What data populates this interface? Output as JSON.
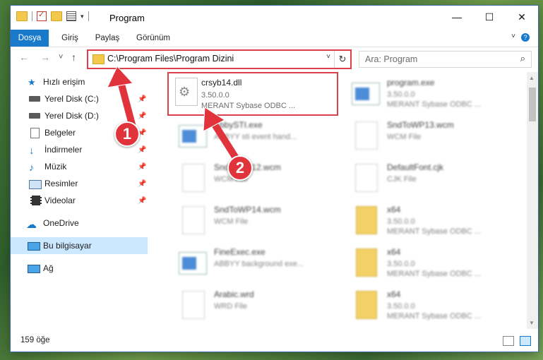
{
  "window": {
    "title": "Program",
    "controls": [
      "—",
      "☐",
      "✕"
    ]
  },
  "ribbon": {
    "tabs": [
      "Dosya",
      "Giriş",
      "Paylaş",
      "Görünüm"
    ],
    "help": "?"
  },
  "navigation": {
    "back": "←",
    "forward": "→",
    "recent": "˅",
    "up": "↑"
  },
  "address": {
    "path": "C:\\Program Files\\Program Dizini",
    "dropdown": "˅",
    "refresh": "↻"
  },
  "search": {
    "placeholder": "Ara: Program",
    "icon": "⌕"
  },
  "sidebar": {
    "quick_access": "Hızlı erişim",
    "items": [
      {
        "label": "Yerel Disk (C:)",
        "icon": "drive-icon",
        "pinned": true
      },
      {
        "label": "Yerel Disk (D:)",
        "icon": "drive-icon",
        "pinned": true
      },
      {
        "label": "Belgeler",
        "icon": "documents-icon",
        "pinned": true
      },
      {
        "label": "İndirmeler",
        "icon": "download-icon",
        "pinned": true
      },
      {
        "label": "Müzik",
        "icon": "music-icon",
        "pinned": true
      },
      {
        "label": "Resimler",
        "icon": "pictures-icon",
        "pinned": true
      },
      {
        "label": "Videolar",
        "icon": "videos-icon",
        "pinned": true
      }
    ],
    "onedrive": "OneDrive",
    "this_pc": "Bu bilgisayar",
    "network": "Ağ"
  },
  "files": [
    {
      "name": "crsyb14.dll",
      "line2": "3.50.0.0",
      "line3": "MERANT Sybase ODBC ...",
      "type": "dll",
      "highlighted": true
    },
    {
      "name": "program.exe",
      "line2": "3.50.0.0",
      "line3": "MERANT Sybase ODBC ...",
      "type": "exe"
    },
    {
      "name": "AbbySTI.exe",
      "line2": "ABBYY sti event hand...",
      "line3": "",
      "type": "exe"
    },
    {
      "name": "SndToWP13.wcm",
      "line2": "WCM File",
      "line3": "",
      "type": "doc"
    },
    {
      "name": "SndToWP12.wcm",
      "line2": "WCM File",
      "line3": "",
      "type": "doc"
    },
    {
      "name": "DefaultFont.cjk",
      "line2": "CJK File",
      "line3": "",
      "type": "doc"
    },
    {
      "name": "SndToWP14.wcm",
      "line2": "WCM File",
      "line3": "",
      "type": "doc"
    },
    {
      "name": "x64",
      "line2": "3.50.0.0",
      "line3": "MERANT Sybase ODBC ...",
      "type": "zip"
    },
    {
      "name": "FineExec.exe",
      "line2": "ABBYY background exe...",
      "line3": "",
      "type": "exe"
    },
    {
      "name": "x64",
      "line2": "3.50.0.0",
      "line3": "MERANT Sybase ODBC ...",
      "type": "zip"
    },
    {
      "name": "Arabic.wrd",
      "line2": "WRD File",
      "line3": "",
      "type": "doc"
    },
    {
      "name": "x64",
      "line2": "3.50.0.0",
      "line3": "MERANT Sybase ODBC ...",
      "type": "zip"
    }
  ],
  "status": {
    "count": "159 öğe"
  },
  "callouts": [
    "1",
    "2"
  ],
  "colors": {
    "accent": "#1979ca",
    "highlight": "#d9404a",
    "selection": "#cce8ff"
  }
}
